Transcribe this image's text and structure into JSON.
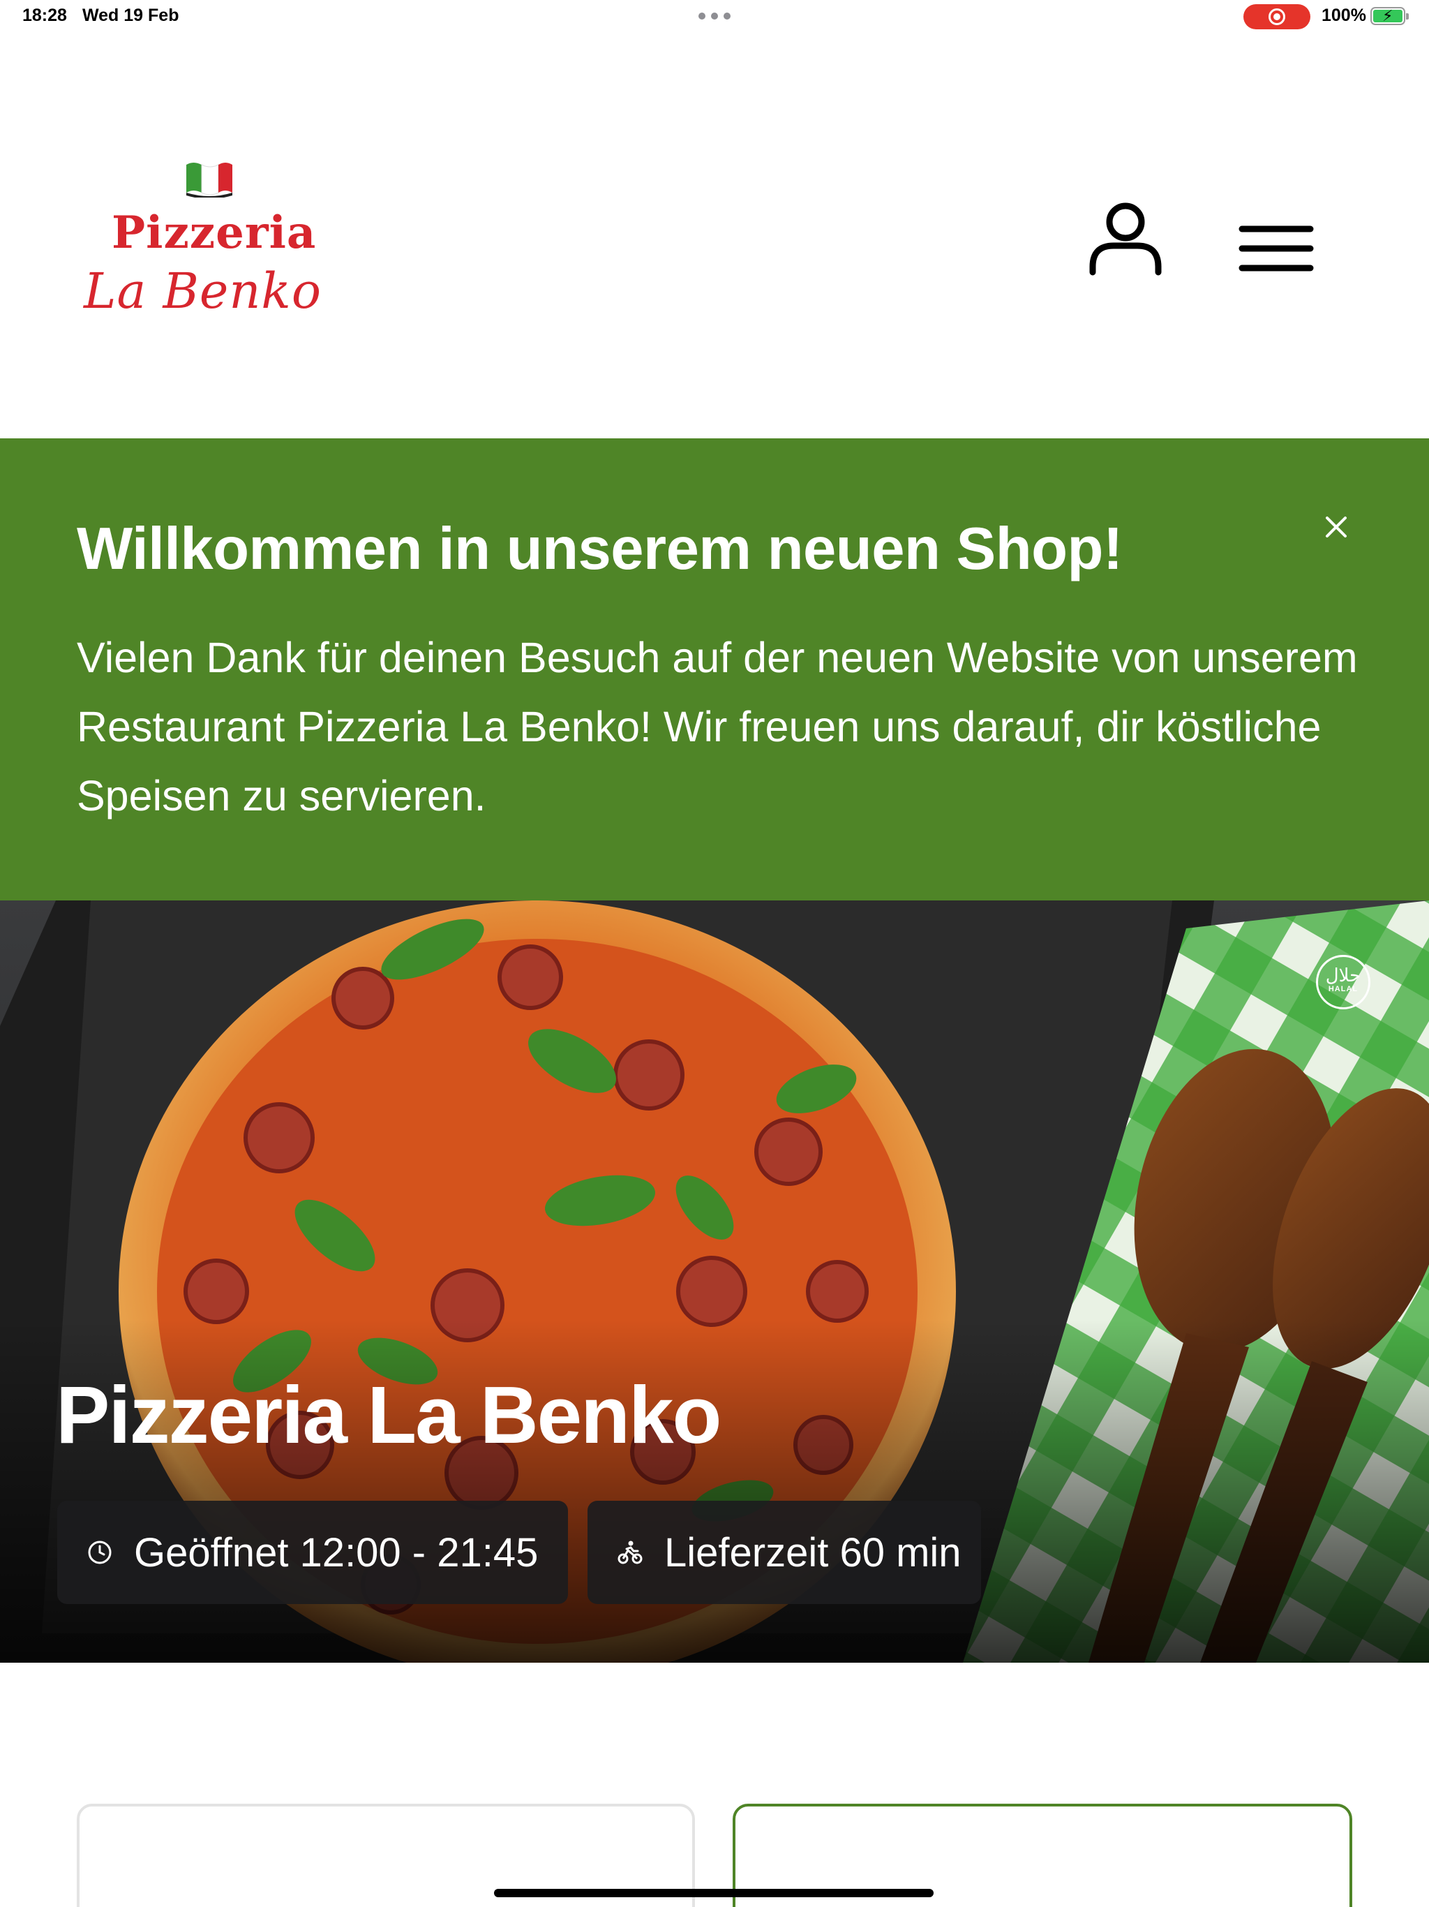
{
  "status_bar": {
    "time": "18:28",
    "date": "Wed 19 Feb",
    "battery": "100%",
    "recording_color": "#e5342a"
  },
  "header": {
    "logo": {
      "line1": "Pizzeria",
      "line2": "La Benko",
      "brand_color": "#d7262e"
    },
    "icons": {
      "account": "user-icon",
      "menu": "hamburger-menu-icon"
    }
  },
  "banner": {
    "title": "Willkommen in unserem neuen Shop!",
    "text": "Vielen Dank für deinen Besuch auf der neuen Website von unserem Restaurant Pizzeria La Benko! Wir freuen uns darauf, dir köstliche Speisen zu servieren.",
    "background_color": "#4f8527",
    "close_icon": "close-icon"
  },
  "hero": {
    "title": "Pizzeria La Benko",
    "halal_badge_arabic": "حلال",
    "halal_badge_text": "HALAL",
    "opening_hours": "Geöffnet 12:00 - 21:45",
    "delivery_time": "Lieferzeit 60 min",
    "icons": {
      "opening_hours": "clock-icon",
      "delivery_time": "delivery-bike-icon"
    }
  }
}
